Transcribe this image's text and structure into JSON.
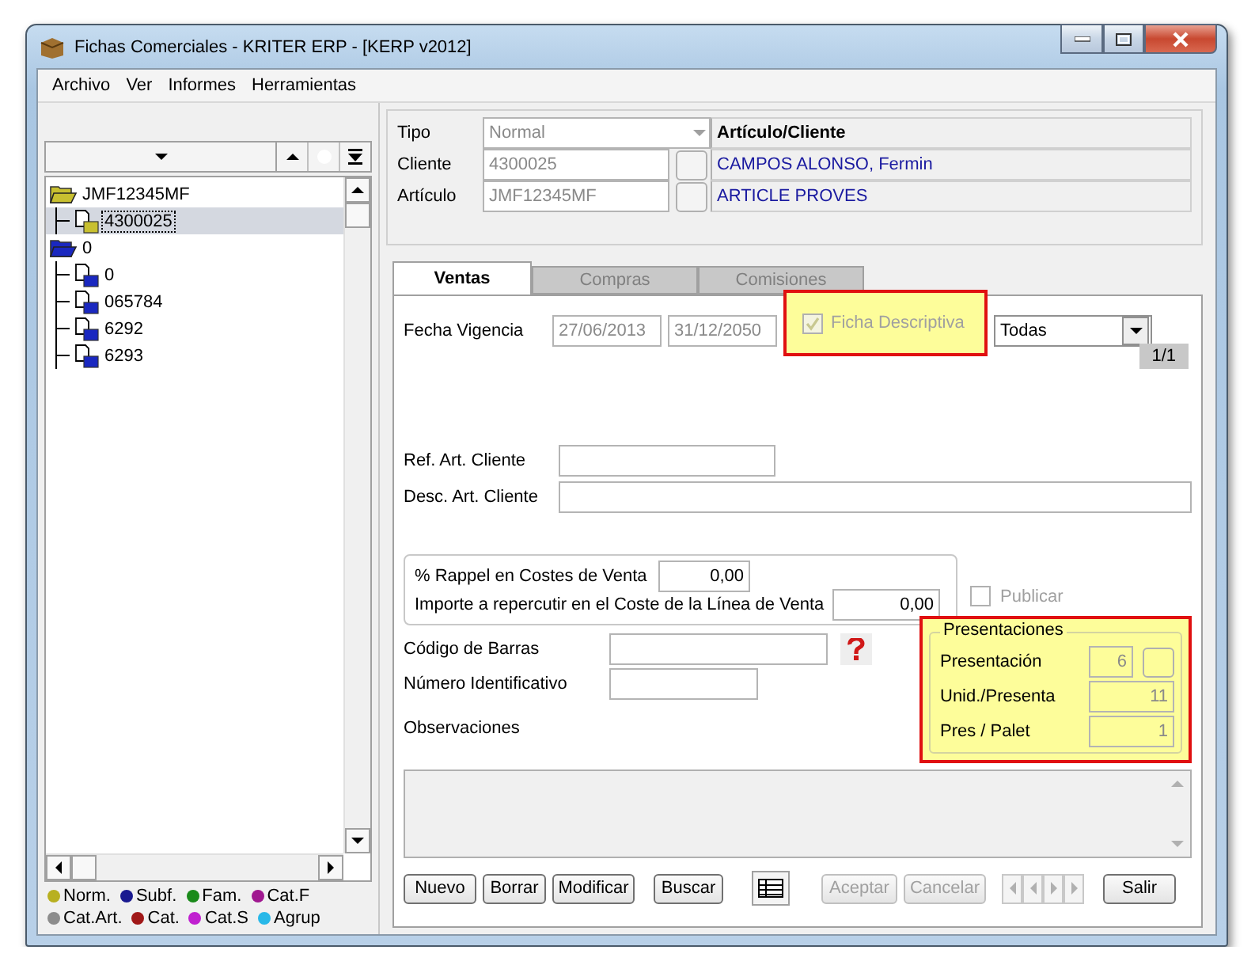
{
  "window": {
    "title": "Fichas Comerciales - KRITER ERP -  [KERP v2012]"
  },
  "menu": [
    "Archivo",
    "Ver",
    "Informes",
    "Herramientas"
  ],
  "tree": {
    "items": [
      {
        "label": "JMF12345MF",
        "kind": "folder",
        "color": "#c8c030",
        "selected": false,
        "children": [
          {
            "label": "4300025",
            "kind": "document",
            "color": "#c8c030",
            "selected": true
          }
        ]
      },
      {
        "label": "0",
        "kind": "folder",
        "color": "#1a28c0",
        "selected": false,
        "children": [
          {
            "label": "0",
            "kind": "document",
            "color": "#1a28c0",
            "selected": false
          },
          {
            "label": "065784",
            "kind": "document",
            "color": "#1a28c0",
            "selected": false
          },
          {
            "label": "6292",
            "kind": "document",
            "color": "#1a28c0",
            "selected": false
          },
          {
            "label": "6293",
            "kind": "document",
            "color": "#1a28c0",
            "selected": false
          }
        ]
      }
    ]
  },
  "legend": [
    {
      "label": "Norm.",
      "color": "#b8b020"
    },
    {
      "label": "Subf.",
      "color": "#1a1a90"
    },
    {
      "label": "Fam.",
      "color": "#1a8a1a"
    },
    {
      "label": "Cat.F",
      "color": "#a01890"
    },
    {
      "label": "Cat.Art.",
      "color": "#8c8c8c"
    },
    {
      "label": "Cat.",
      "color": "#a01818"
    },
    {
      "label": "Cat.S",
      "color": "#c020d0"
    },
    {
      "label": "Agrup",
      "color": "#28b8e8"
    }
  ],
  "header": {
    "title": "Artículo/Cliente",
    "tipo": {
      "label": "Tipo",
      "value": "Normal"
    },
    "rows": [
      {
        "label": "Cliente",
        "value": "4300025",
        "name": "CAMPOS ALONSO, Fermin"
      },
      {
        "label": "Artículo",
        "value": "JMF12345MF",
        "name": "ARTICLE PROVES"
      }
    ]
  },
  "tabs": [
    {
      "label": "Ventas",
      "selected": true
    },
    {
      "label": "Compras",
      "selected": false
    },
    {
      "label": "Comisiones",
      "selected": false
    }
  ],
  "ventas": {
    "fecha_vigencia": {
      "label": "Fecha Vigencia",
      "from": "27/06/2013",
      "to": "31/12/2050"
    },
    "ficha_descriptiva": {
      "label": "Ficha Descriptiva",
      "checked": true,
      "highlighted": true
    },
    "filter": {
      "value": "Todas"
    },
    "pager": "1/1",
    "ref_art_cliente": {
      "label": "Ref. Art. Cliente"
    },
    "desc_art_cliente": {
      "label": "Desc. Art. Cliente"
    },
    "rappel": {
      "label": "% Rappel en Costes de Venta",
      "value": "0,00"
    },
    "importe": {
      "label": "Importe a repercutir en el Coste de la Línea de Venta",
      "value": "0,00"
    },
    "publicar": {
      "label": "Publicar",
      "checked": false
    },
    "codigo_barras": {
      "label": "Código de Barras"
    },
    "numero_identificativo": {
      "label": "Número Identificativo"
    },
    "presentaciones": {
      "title": "Presentaciones",
      "highlighted": true,
      "rows": [
        {
          "label": "Presentación",
          "value": "6",
          "kind": "lookup"
        },
        {
          "label": "Unid./Presenta",
          "value": "11",
          "kind": "plain"
        },
        {
          "label": "Pres / Palet",
          "value": "1",
          "kind": "plain"
        }
      ]
    },
    "observaciones": {
      "label": "Observaciones"
    }
  },
  "buttons": [
    {
      "kind": "text",
      "label": "Nuevo",
      "disabled": false
    },
    {
      "kind": "text",
      "label": "Borrar",
      "disabled": false
    },
    {
      "kind": "text",
      "label": "Modificar",
      "disabled": false
    },
    {
      "kind": "text",
      "label": "Buscar",
      "disabled": false
    },
    {
      "kind": "grid",
      "disabled": false
    },
    {
      "kind": "text",
      "label": "Aceptar",
      "disabled": true
    },
    {
      "kind": "text",
      "label": "Cancelar",
      "disabled": true
    },
    {
      "kind": "nav",
      "disabled": true
    },
    {
      "kind": "text",
      "label": "Salir",
      "disabled": false
    }
  ]
}
